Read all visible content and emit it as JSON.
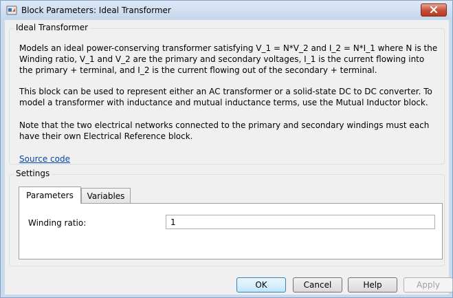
{
  "window": {
    "title": "Block Parameters: Ideal Transformer",
    "close_symbol": "×"
  },
  "description": {
    "group_title": "Ideal Transformer",
    "paragraph_1": "Models an ideal power-conserving transformer satisfying V_1 = N*V_2 and I_2 = N*I_1 where N is the Winding ratio, V_1 and V_2 are the primary and secondary voltages, I_1 is the current flowing into the primary + terminal, and I_2 is the current flowing out of the secondary + terminal.",
    "paragraph_2": "This block can be used to represent either an AC transformer or a solid-state DC to DC converter. To model a transformer with inductance and mutual inductance terms, use the Mutual Inductor block.",
    "paragraph_3": "Note that the two electrical networks connected to the primary and secondary windings must each have their own Electrical Reference block.",
    "source_link": "Source code"
  },
  "settings": {
    "group_title": "Settings",
    "tabs": [
      {
        "label": "Parameters",
        "active": true
      },
      {
        "label": "Variables",
        "active": false
      }
    ],
    "parameters": [
      {
        "label": "Winding ratio:",
        "value": "1"
      }
    ]
  },
  "buttons": {
    "ok": "OK",
    "cancel": "Cancel",
    "help": "Help",
    "apply": "Apply"
  },
  "colors": {
    "link": "#0645ad",
    "close_button": "#c74d35",
    "title_bar": "#c9daee"
  },
  "icons": {
    "app": "simulink-block-icon",
    "close": "close-icon"
  }
}
